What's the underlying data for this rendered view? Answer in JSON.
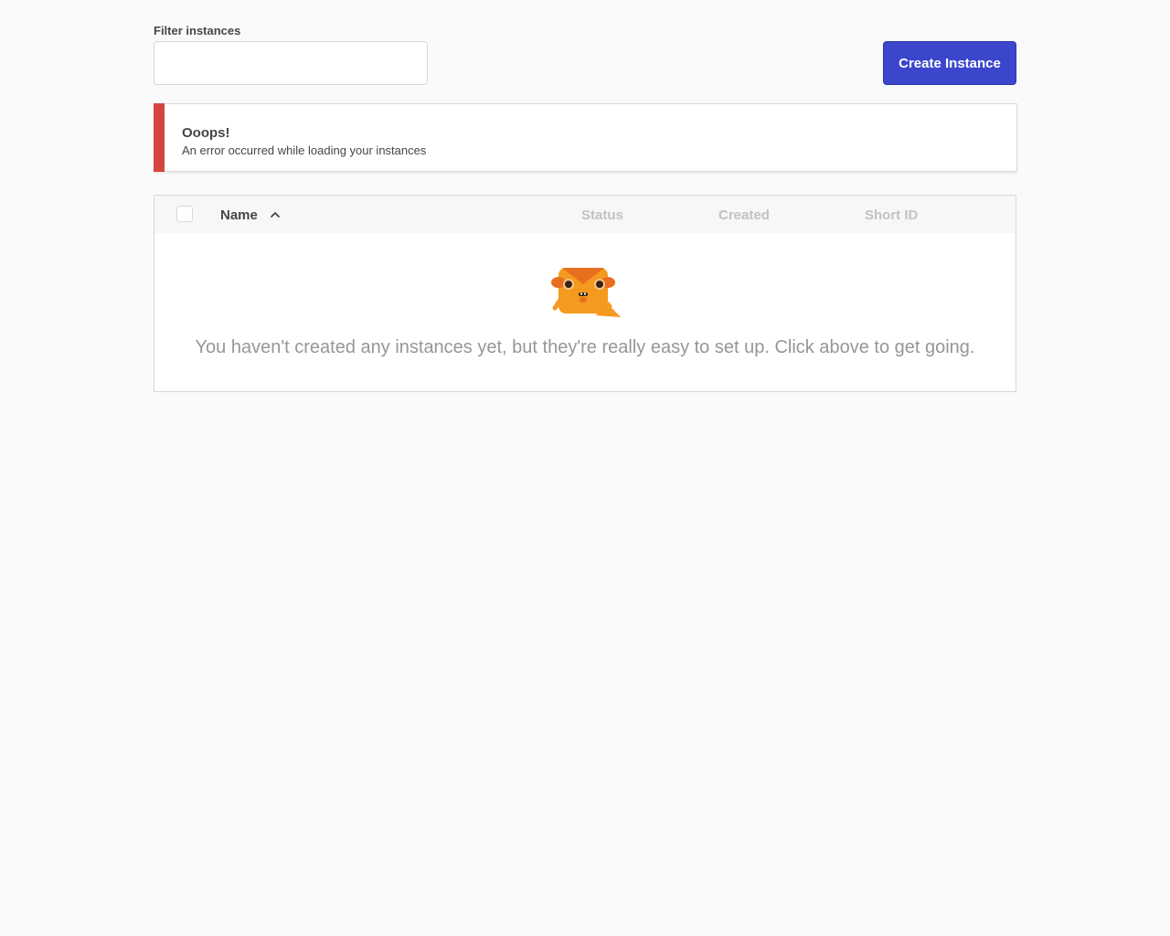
{
  "filter": {
    "label": "Filter instances",
    "value": "",
    "placeholder": ""
  },
  "actions": {
    "create_label": "Create Instance"
  },
  "alert": {
    "title": "Ooops!",
    "message": "An error occurred while loading your instances",
    "accent_color": "#d6453d"
  },
  "table": {
    "columns": {
      "name": "Name",
      "status": "Status",
      "created": "Created",
      "short_id": "Short ID"
    },
    "sort_column": "Name",
    "sort_direction": "ascending",
    "empty_message": "You haven't created any instances yet, but they're really easy to set up. Click above to get going."
  },
  "colors": {
    "primary": "#3b46cc",
    "error": "#d6453d",
    "background": "#fafafa"
  }
}
